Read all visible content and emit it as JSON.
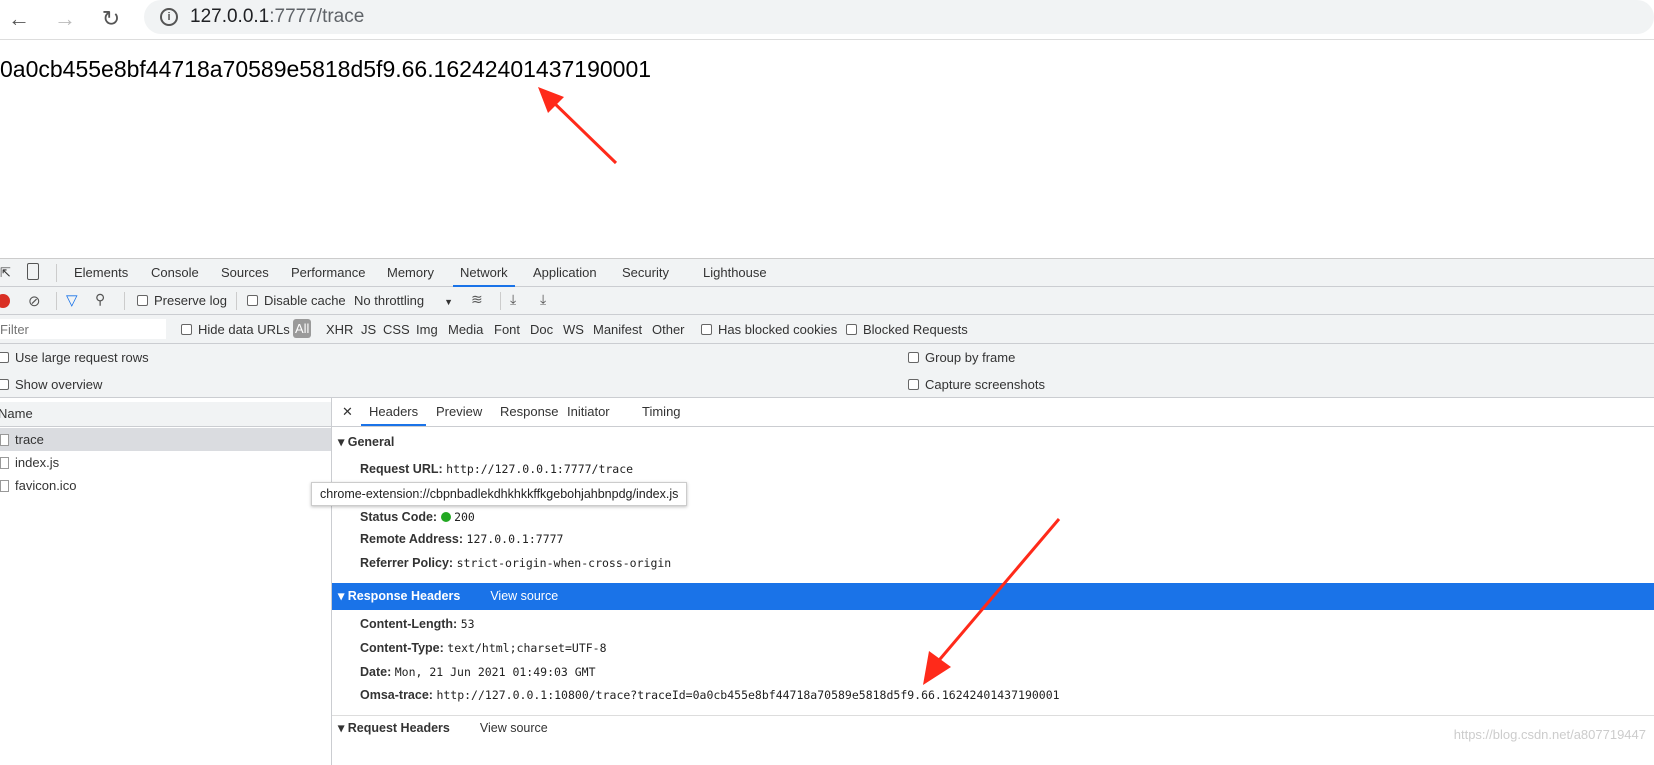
{
  "browser": {
    "url_host": "127.0.0.1",
    "url_path": ":7777/trace",
    "back_icon": "arrow-left",
    "forward_icon": "arrow-right",
    "reload_icon": "reload",
    "info_icon": "info-circle"
  },
  "page": {
    "text": "0a0cb455e8bf44718a70589e5818d5f9.66.16242401437190001"
  },
  "devtools": {
    "tabs": [
      "Elements",
      "Console",
      "Sources",
      "Performance",
      "Memory",
      "Network",
      "Application",
      "Security",
      "Lighthouse"
    ],
    "active_tab": "Network",
    "toolbar": {
      "preserve_log": "Preserve log",
      "disable_cache": "Disable cache",
      "throttling": "No throttling"
    },
    "filter": {
      "placeholder": "Filter",
      "hide_data_urls": "Hide data URLs",
      "types": [
        "All",
        "XHR",
        "JS",
        "CSS",
        "Img",
        "Media",
        "Font",
        "Doc",
        "WS",
        "Manifest",
        "Other"
      ],
      "has_blocked_cookies": "Has blocked cookies",
      "blocked_requests": "Blocked Requests"
    },
    "settings": {
      "large_rows": "Use large request rows",
      "overview": "Show overview",
      "group_by_frame": "Group by frame",
      "capture_screenshots": "Capture screenshots"
    },
    "requests": {
      "header": "Name",
      "items": [
        "trace",
        "index.js",
        "favicon.ico"
      ]
    },
    "tooltip": "chrome-extension://cbpnbadlekdhkhkkffkgebohjahbnpdg/index.js",
    "detail_tabs": [
      "Headers",
      "Preview",
      "Response",
      "Initiator",
      "Timing"
    ],
    "general": {
      "title": "General",
      "rows": [
        {
          "k": "Request URL:",
          "v": "http://127.0.0.1:7777/trace"
        },
        {
          "k": "Status Code:",
          "v": "200"
        },
        {
          "k": "Remote Address:",
          "v": "127.0.0.1:7777"
        },
        {
          "k": "Referrer Policy:",
          "v": "strict-origin-when-cross-origin"
        }
      ]
    },
    "response_headers": {
      "title": "Response Headers",
      "view_source": "View source",
      "rows": [
        {
          "k": "Content-Length:",
          "v": "53"
        },
        {
          "k": "Content-Type:",
          "v": "text/html;charset=UTF-8"
        },
        {
          "k": "Date:",
          "v": "Mon, 21 Jun 2021 01:49:03 GMT"
        },
        {
          "k": "Omsa-trace:",
          "v": "http://127.0.0.1:10800/trace?traceId=0a0cb455e8bf44718a70589e5818d5f9.66.16242401437190001"
        }
      ]
    },
    "request_headers": {
      "title": "Request Headers",
      "view_source": "View source"
    }
  },
  "watermark": "https://blog.csdn.net/a807719447",
  "colors": {
    "accent": "#1a73e8",
    "record": "#d93025",
    "annotation_arrow": "#ff2a1a",
    "status_ok": "#22a822"
  }
}
